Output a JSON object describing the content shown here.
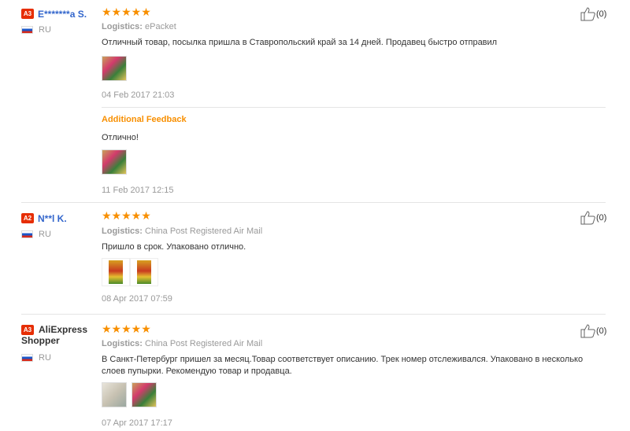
{
  "reviews": [
    {
      "badge": "A3",
      "user": "E*******a S.",
      "country": "RU",
      "stars": "★★★★★",
      "logistics_label": "Logistics:",
      "logistics": "ePacket",
      "text": "Отличный товар, посылка пришла в Ставропольский край за 14 дней. Продавец быстро отправил",
      "date": "04 Feb 2017 21:03",
      "likes": "(0)",
      "additional": {
        "label": "Additional Feedback",
        "text": "Отлично!",
        "date": "11 Feb 2017 12:15"
      }
    },
    {
      "badge": "A2",
      "user": "N**l K.",
      "country": "RU",
      "stars": "★★★★★",
      "logistics_label": "Logistics:",
      "logistics": "China Post Registered Air Mail",
      "text": "Пришло в срок. Упаковано отлично.",
      "date": "08 Apr 2017 07:59",
      "likes": "(0)"
    },
    {
      "badge": "A3",
      "user_line1": "AliExpress",
      "user_line2": "Shopper",
      "country": "RU",
      "stars": "★★★★★",
      "logistics_label": "Logistics:",
      "logistics": "China Post Registered Air Mail",
      "text": "В Санкт-Петербург пришел за месяц.Товар соответствует описанию. Трек номер отслеживался. Упаковано в несколько слоев пупырки. Рекомендую товар и продавца.",
      "date": "07 Apr 2017 17:17",
      "likes": "(0)"
    }
  ],
  "colors": {
    "star": "#f88f00",
    "badge": "#e62e04",
    "username": "#3366cc",
    "muted": "#999999"
  }
}
